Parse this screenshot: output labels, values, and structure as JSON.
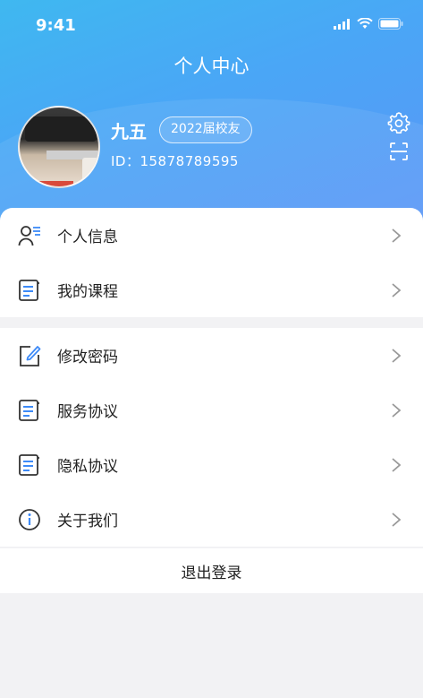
{
  "status_bar": {
    "time": "9:41"
  },
  "header": {
    "title": "个人中心",
    "user_name": "九五",
    "badge": "2022届校友",
    "user_id": "ID：15878789595"
  },
  "menu_group_1": [
    {
      "label": "个人信息",
      "icon": "person-list-icon"
    },
    {
      "label": "我的课程",
      "icon": "document-icon"
    }
  ],
  "menu_group_2": [
    {
      "label": "修改密码",
      "icon": "edit-icon"
    },
    {
      "label": "服务协议",
      "icon": "document-icon"
    },
    {
      "label": "隐私协议",
      "icon": "document-icon"
    },
    {
      "label": "关于我们",
      "icon": "info-icon"
    }
  ],
  "logout_label": "退出登录",
  "colors": {
    "accent": "#3d8af7",
    "header_start": "#3fb8f0",
    "header_end": "#5a96f7"
  }
}
